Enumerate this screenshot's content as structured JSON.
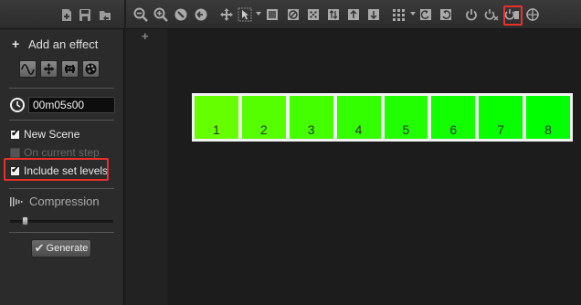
{
  "left_panel": {
    "add_effect_label": "Add an effect",
    "time_value": "00m05s00",
    "new_scene_label": "New Scene",
    "new_scene_checked": true,
    "on_current_step_label": "On current step",
    "on_current_step_enabled": false,
    "include_set_levels_label": "Include set levels",
    "include_set_levels_checked": true,
    "compression_label": "Compression",
    "compression_level": 0.12,
    "generate_label": "Generate",
    "check_glyph": "✔",
    "plus_glyph": "+"
  },
  "fixtures": [
    {
      "label": "1",
      "color": "#66ff00"
    },
    {
      "label": "2",
      "color": "#55ff00"
    },
    {
      "label": "3",
      "color": "#44ff00"
    },
    {
      "label": "4",
      "color": "#33ff00"
    },
    {
      "label": "5",
      "color": "#22ff00"
    },
    {
      "label": "6",
      "color": "#11ff00"
    },
    {
      "label": "7",
      "color": "#08ff00"
    },
    {
      "label": "8",
      "color": "#00ff00"
    }
  ],
  "canvas": {
    "add_glyph": "+"
  },
  "colors": {
    "highlight": "#e8312a",
    "panel": "#2b2b2b",
    "canvas": "#1c1c1c"
  }
}
